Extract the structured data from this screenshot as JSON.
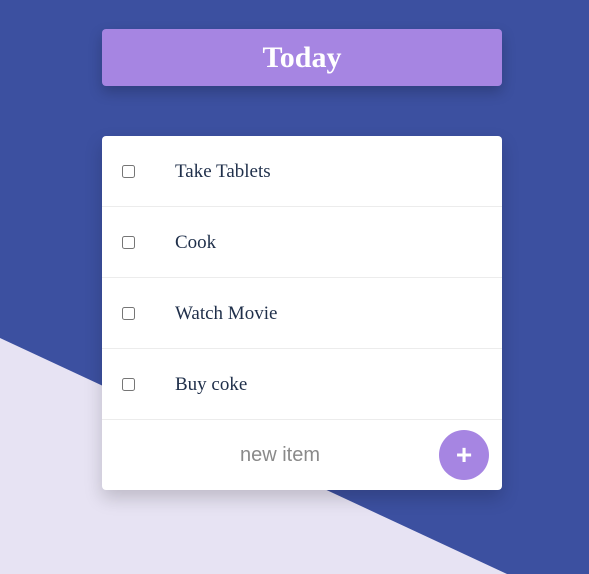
{
  "header": {
    "title": "Today"
  },
  "todos": [
    {
      "label": "Take Tablets",
      "checked": false
    },
    {
      "label": "Cook",
      "checked": false
    },
    {
      "label": "Watch Movie",
      "checked": false
    },
    {
      "label": "Buy coke",
      "checked": false
    }
  ],
  "new_item": {
    "placeholder": "new item",
    "add_label": "+"
  },
  "colors": {
    "background": "#3c50a0",
    "wedge": "#e7e3f3",
    "accent": "#a685e2",
    "card": "#ffffff",
    "item_text": "#1f2f4a"
  }
}
